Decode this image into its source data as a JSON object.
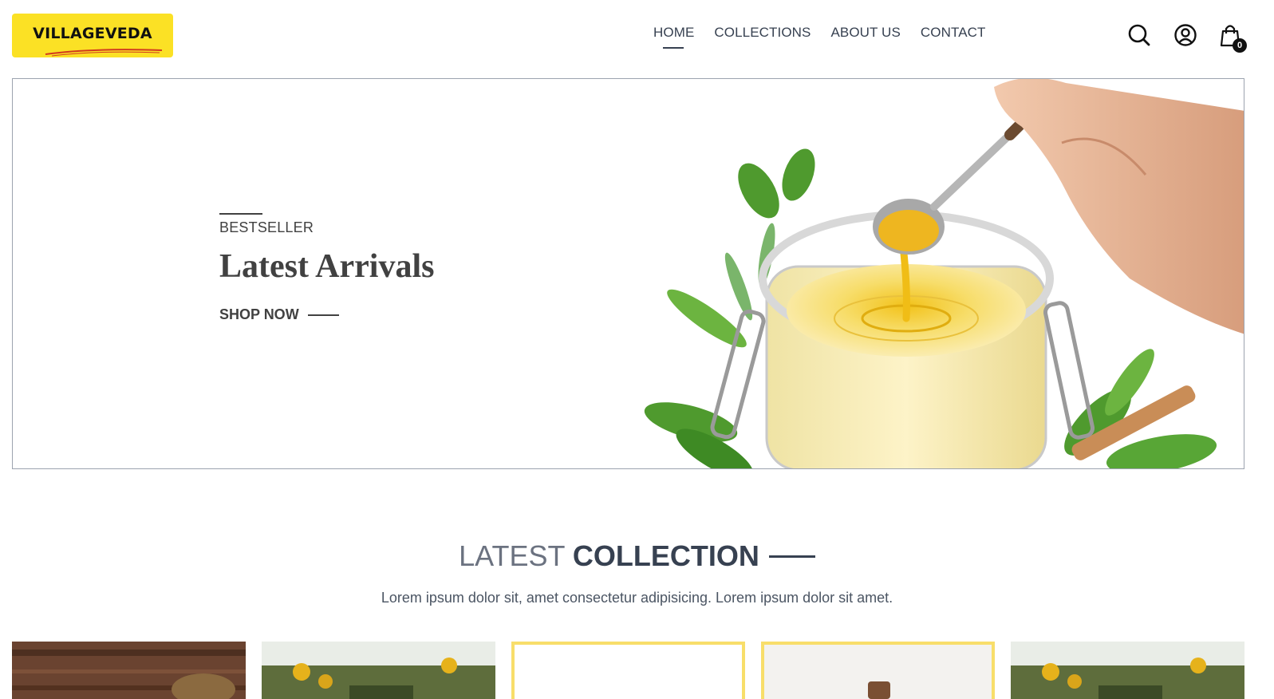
{
  "brand": {
    "name": "VILLAGEVEDA",
    "accent": "#fbe125"
  },
  "nav": {
    "items": [
      {
        "label": "HOME",
        "active": true
      },
      {
        "label": "COLLECTIONS",
        "active": false
      },
      {
        "label": "ABOUT US",
        "active": false
      },
      {
        "label": "CONTACT",
        "active": false
      }
    ]
  },
  "header_icons": {
    "search": "search-icon",
    "profile": "user-circle-icon",
    "cart": "shopping-bag-icon",
    "cart_count": "0"
  },
  "hero": {
    "tag": "BESTSELLER",
    "title": "Latest Arrivals",
    "cta": "SHOP NOW",
    "image": "ghee jar with spoon and herbs"
  },
  "collection": {
    "title_light": "LATEST",
    "title_bold": "COLLECTION",
    "subtitle": "Lorem ipsum dolor sit, amet consectetur adipisicing. Lorem ipsum dolor sit amet.",
    "products": [
      {
        "image": "wooden table with jar"
      },
      {
        "image": "sunflower field"
      },
      {
        "image": "white product on yellow frame"
      },
      {
        "image": "bottle with cork on yellow frame"
      },
      {
        "image": "sunflower field"
      }
    ]
  }
}
